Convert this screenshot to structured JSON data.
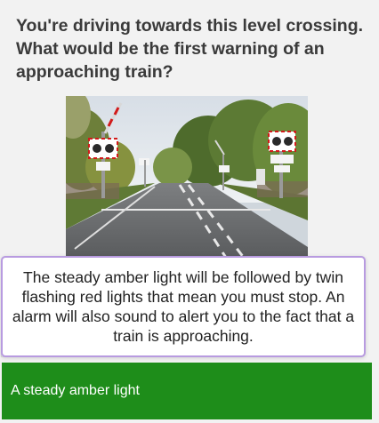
{
  "question": {
    "text": "You're driving towards this level crossing. What would be the first warning of an approaching train?"
  },
  "image": {
    "subject": "level-crossing-photo"
  },
  "explanation": {
    "text": "The steady amber light will be followed by twin flashing red lights that mean you must stop. An alarm will also sound to alert you to the fact that a train is approaching.",
    "border_color": "#b89be0"
  },
  "answer": {
    "label": "A steady amber light",
    "background_color": "#1e8d1a",
    "state": "correct"
  }
}
